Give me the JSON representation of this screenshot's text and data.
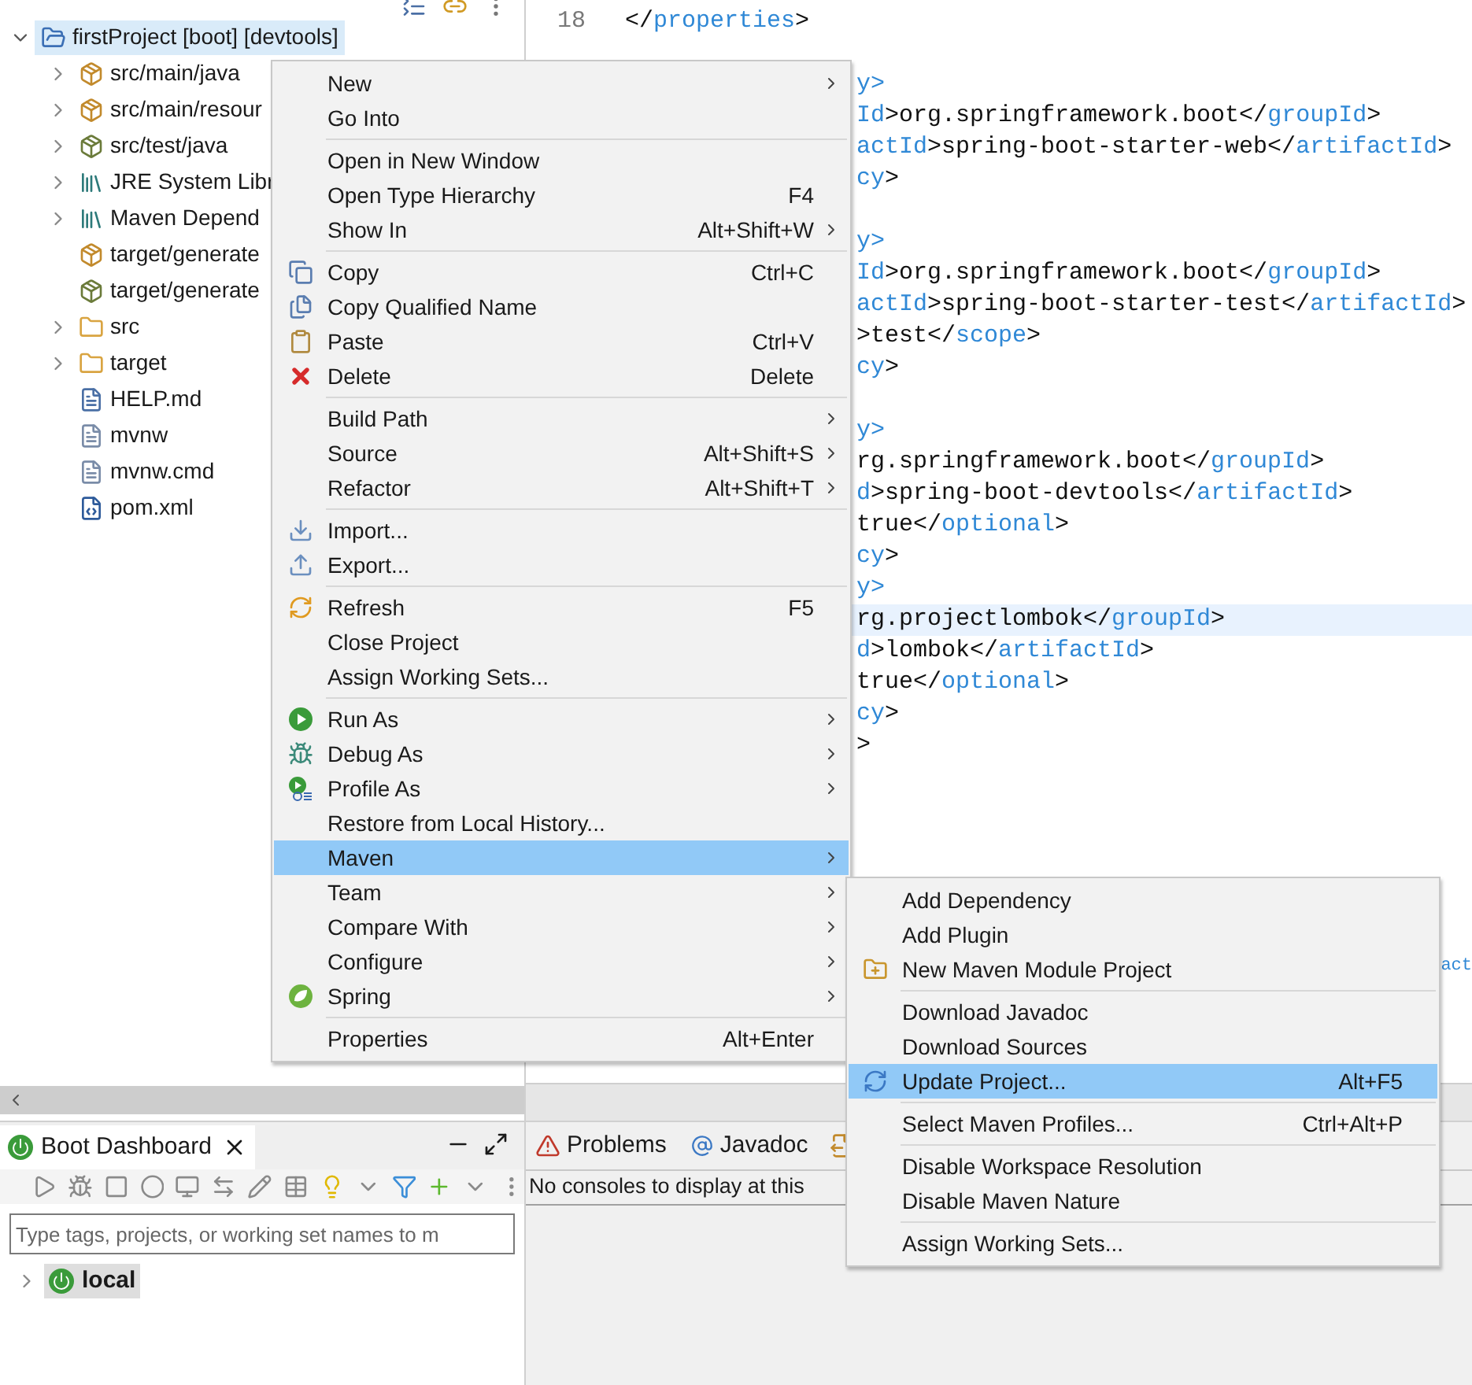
{
  "explorer": {
    "tree": [
      {
        "label": "firstProject [boot] [devtools]",
        "kind": "project",
        "expanded": true,
        "selected": true,
        "children": [
          {
            "label": "src/main/java",
            "kind": "source",
            "expanded": false,
            "selected": false
          },
          {
            "label": "src/main/resour",
            "kind": "source",
            "expanded": false,
            "selected": false
          },
          {
            "label": "src/test/java",
            "kind": "testsource",
            "expanded": false,
            "selected": false
          },
          {
            "label": "JRE System Libr",
            "kind": "library",
            "expanded": false,
            "selected": false
          },
          {
            "label": "Maven Depend",
            "kind": "library",
            "expanded": false,
            "selected": false
          },
          {
            "label": "target/generate",
            "kind": "source",
            "selected": false
          },
          {
            "label": "target/generate",
            "kind": "testsource",
            "selected": false
          },
          {
            "label": "src",
            "kind": "folder",
            "expanded": false,
            "selected": false
          },
          {
            "label": "target",
            "kind": "folder",
            "expanded": false,
            "selected": false
          },
          {
            "label": "HELP.md",
            "kind": "document",
            "selected": false
          },
          {
            "label": "mvnw",
            "kind": "file",
            "selected": false
          },
          {
            "label": "mvnw.cmd",
            "kind": "file",
            "selected": false
          },
          {
            "label": "pom.xml",
            "kind": "xml",
            "selected": false
          }
        ]
      }
    ]
  },
  "editor": {
    "line_number": "18",
    "first_line": [
      {
        "text": "</",
        "kind": "plain"
      },
      {
        "text": "properties",
        "kind": "tag"
      },
      {
        "text": ">",
        "kind": "plain"
      }
    ],
    "lines": [
      {
        "kind": "blank"
      },
      {
        "kind": "code",
        "segments": [
          {
            "text": "y>",
            "kind": "tag"
          }
        ]
      },
      {
        "kind": "code",
        "segments": [
          {
            "text": "Id",
            "kind": "tag"
          },
          {
            "text": ">org.springframework.boot</",
            "kind": "plain"
          },
          {
            "text": "groupId",
            "kind": "tag"
          },
          {
            "text": ">",
            "kind": "plain"
          }
        ]
      },
      {
        "kind": "code",
        "segments": [
          {
            "text": "actId",
            "kind": "tag"
          },
          {
            "text": ">spring-boot-starter-web</",
            "kind": "plain"
          },
          {
            "text": "artifactId",
            "kind": "tag"
          },
          {
            "text": ">",
            "kind": "plain"
          }
        ]
      },
      {
        "kind": "code",
        "segments": [
          {
            "text": "cy",
            "kind": "tag"
          },
          {
            "text": ">",
            "kind": "plain"
          }
        ]
      },
      {
        "kind": "blank"
      },
      {
        "kind": "code",
        "segments": [
          {
            "text": "y>",
            "kind": "tag"
          }
        ]
      },
      {
        "kind": "code",
        "segments": [
          {
            "text": "Id",
            "kind": "tag"
          },
          {
            "text": ">org.springframework.boot</",
            "kind": "plain"
          },
          {
            "text": "groupId",
            "kind": "tag"
          },
          {
            "text": ">",
            "kind": "plain"
          }
        ]
      },
      {
        "kind": "code",
        "segments": [
          {
            "text": "actId",
            "kind": "tag"
          },
          {
            "text": ">spring-boot-starter-test</",
            "kind": "plain"
          },
          {
            "text": "artifactId",
            "kind": "tag"
          },
          {
            "text": ">",
            "kind": "plain"
          }
        ]
      },
      {
        "kind": "code",
        "segments": [
          {
            "text": ">test</",
            "kind": "plain"
          },
          {
            "text": "scope",
            "kind": "tag"
          },
          {
            "text": ">",
            "kind": "plain"
          }
        ]
      },
      {
        "kind": "code",
        "segments": [
          {
            "text": "cy",
            "kind": "tag"
          },
          {
            "text": ">",
            "kind": "plain"
          }
        ]
      },
      {
        "kind": "blank"
      },
      {
        "kind": "code",
        "segments": [
          {
            "text": "y>",
            "kind": "tag"
          }
        ]
      },
      {
        "kind": "code",
        "segments": [
          {
            "text": "rg.springframework.boot</",
            "kind": "plain"
          },
          {
            "text": "groupId",
            "kind": "tag"
          },
          {
            "text": ">",
            "kind": "plain"
          }
        ]
      },
      {
        "kind": "code",
        "segments": [
          {
            "text": "d",
            "kind": "tag"
          },
          {
            "text": ">spring-boot-devtools</",
            "kind": "plain"
          },
          {
            "text": "artifactId",
            "kind": "tag"
          },
          {
            "text": ">",
            "kind": "plain"
          }
        ]
      },
      {
        "kind": "code",
        "segments": [
          {
            "text": "true</",
            "kind": "plain"
          },
          {
            "text": "optional",
            "kind": "tag"
          },
          {
            "text": ">",
            "kind": "plain"
          }
        ]
      },
      {
        "kind": "code",
        "segments": [
          {
            "text": "cy",
            "kind": "tag"
          },
          {
            "text": ">",
            "kind": "plain"
          }
        ]
      },
      {
        "kind": "code",
        "segments": [
          {
            "text": "y>",
            "kind": "tag"
          }
        ]
      },
      {
        "kind": "current",
        "segments": [
          {
            "text": "rg.projectlombok</",
            "kind": "plain"
          },
          {
            "text": "groupId",
            "kind": "tag"
          },
          {
            "text": ">",
            "kind": "plain"
          }
        ]
      },
      {
        "kind": "code",
        "segments": [
          {
            "text": "d",
            "kind": "tag"
          },
          {
            "text": ">lombok</",
            "kind": "plain"
          },
          {
            "text": "artifactId",
            "kind": "tag"
          },
          {
            "text": ">",
            "kind": "plain"
          }
        ]
      },
      {
        "kind": "code",
        "segments": [
          {
            "text": "true</",
            "kind": "plain"
          },
          {
            "text": "optional",
            "kind": "tag"
          },
          {
            "text": ">",
            "kind": "plain"
          }
        ]
      },
      {
        "kind": "code",
        "segments": [
          {
            "text": "cy",
            "kind": "tag"
          },
          {
            "text": ">",
            "kind": "plain"
          }
        ]
      },
      {
        "kind": "code",
        "segments": [
          {
            "text": ">",
            "kind": "plain"
          }
        ]
      },
      {
        "kind": "blank"
      },
      {
        "kind": "blank"
      },
      {
        "kind": "blank"
      },
      {
        "kind": "blank"
      },
      {
        "kind": "blank"
      },
      {
        "kind": "blank"
      },
      {
        "kind": "trailing",
        "segments": [
          {
            "text": "act",
            "kind": "tag"
          }
        ]
      }
    ]
  },
  "context_menu": {
    "items": [
      {
        "kind": "plain",
        "label": "New",
        "submenu": true,
        "selected": false
      },
      {
        "kind": "plain",
        "label": "Go Into",
        "selected": false
      },
      {
        "kind": "separator"
      },
      {
        "kind": "plain",
        "label": "Open in New Window",
        "selected": false
      },
      {
        "kind": "plain",
        "label": "Open Type Hierarchy",
        "shortcut": "F4",
        "selected": false
      },
      {
        "kind": "plain",
        "label": "Show In",
        "shortcut": "Alt+Shift+W",
        "submenu": true,
        "selected": false
      },
      {
        "kind": "separator"
      },
      {
        "kind": "copy",
        "label": "Copy",
        "shortcut": "Ctrl+C",
        "selected": false
      },
      {
        "kind": "copyname",
        "label": "Copy Qualified Name",
        "selected": false
      },
      {
        "kind": "paste",
        "label": "Paste",
        "shortcut": "Ctrl+V",
        "selected": false
      },
      {
        "kind": "delete",
        "label": "Delete",
        "shortcut": "Delete",
        "selected": false
      },
      {
        "kind": "separator"
      },
      {
        "kind": "plain",
        "label": "Build Path",
        "submenu": true,
        "selected": false
      },
      {
        "kind": "plain",
        "label": "Source",
        "shortcut": "Alt+Shift+S",
        "submenu": true,
        "selected": false
      },
      {
        "kind": "plain",
        "label": "Refactor",
        "shortcut": "Alt+Shift+T",
        "submenu": true,
        "selected": false
      },
      {
        "kind": "separator"
      },
      {
        "kind": "import",
        "label": "Import...",
        "selected": false
      },
      {
        "kind": "export",
        "label": "Export...",
        "selected": false
      },
      {
        "kind": "separator"
      },
      {
        "kind": "refresh",
        "label": "Refresh",
        "shortcut": "F5",
        "selected": false
      },
      {
        "kind": "plain",
        "label": "Close Project",
        "selected": false
      },
      {
        "kind": "plain",
        "label": "Assign Working Sets...",
        "selected": false
      },
      {
        "kind": "separator"
      },
      {
        "kind": "run",
        "label": "Run As",
        "submenu": true,
        "selected": false
      },
      {
        "kind": "debug",
        "label": "Debug As",
        "submenu": true,
        "selected": false
      },
      {
        "kind": "profile",
        "label": "Profile As",
        "submenu": true,
        "selected": false
      },
      {
        "kind": "plain",
        "label": "Restore from Local History...",
        "selected": false
      },
      {
        "kind": "plain",
        "label": "Maven",
        "submenu": true,
        "selected": true
      },
      {
        "kind": "plain",
        "label": "Team",
        "submenu": true,
        "selected": false
      },
      {
        "kind": "plain",
        "label": "Compare With",
        "submenu": true,
        "selected": false
      },
      {
        "kind": "plain",
        "label": "Configure",
        "submenu": true,
        "selected": false
      },
      {
        "kind": "spring",
        "label": "Spring",
        "submenu": true,
        "selected": false
      },
      {
        "kind": "separator"
      },
      {
        "kind": "plain",
        "label": "Properties",
        "shortcut": "Alt+Enter",
        "selected": false
      }
    ]
  },
  "maven_submenu": {
    "items": [
      {
        "kind": "plain",
        "label": "Add Dependency",
        "selected": false
      },
      {
        "kind": "plain",
        "label": "Add Plugin",
        "selected": false
      },
      {
        "kind": "module",
        "label": "New Maven Module Project",
        "selected": false
      },
      {
        "kind": "separator"
      },
      {
        "kind": "plain",
        "label": "Download Javadoc",
        "selected": false
      },
      {
        "kind": "plain",
        "label": "Download Sources",
        "selected": false
      },
      {
        "kind": "update",
        "label": "Update Project...",
        "shortcut": "Alt+F5",
        "selected": true
      },
      {
        "kind": "separator"
      },
      {
        "kind": "plain",
        "label": "Select Maven Profiles...",
        "shortcut": "Ctrl+Alt+P",
        "selected": false
      },
      {
        "kind": "separator"
      },
      {
        "kind": "plain",
        "label": "Disable Workspace Resolution",
        "selected": false
      },
      {
        "kind": "plain",
        "label": "Disable Maven Nature",
        "selected": false
      },
      {
        "kind": "separator"
      },
      {
        "kind": "plain",
        "label": "Assign Working Sets...",
        "selected": false
      }
    ]
  },
  "boot_dashboard": {
    "tab": "Boot Dashboard",
    "filter": {
      "placeholder": "Type tags, projects, or working set names to m"
    },
    "tree": [
      {
        "label": "local",
        "expanded": false,
        "selected": true
      }
    ]
  },
  "console_panel": {
    "tabs": [
      {
        "label": "Problems",
        "kind": "problems",
        "selected": false
      },
      {
        "label": "Javadoc",
        "kind": "javadoc",
        "selected": false
      }
    ],
    "message": "No consoles to display at this"
  }
}
